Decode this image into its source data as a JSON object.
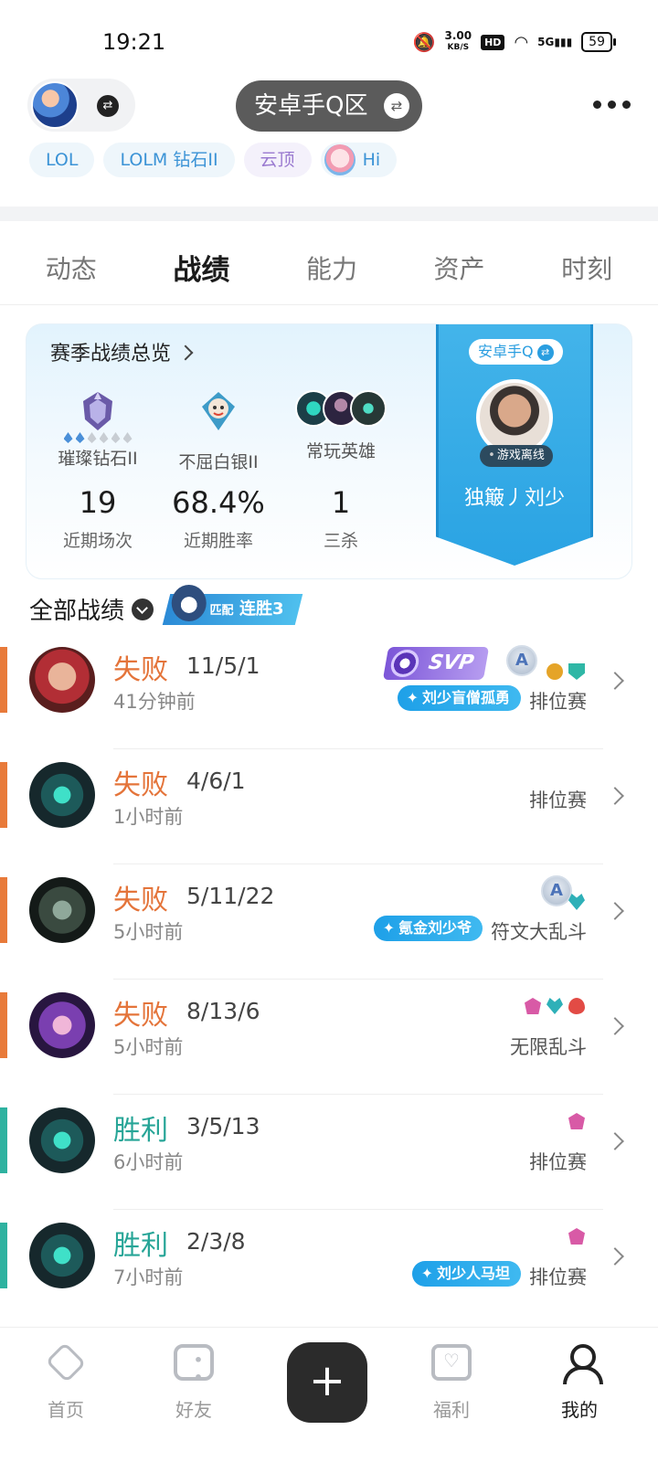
{
  "status_bar": {
    "time": "19:21",
    "speed": "3.00",
    "speed_unit": "KB/S",
    "hd": "HD",
    "network": "5G",
    "battery": "59"
  },
  "header": {
    "region": "安卓手Q区",
    "tags": [
      "LOL",
      "LOLM 钻石II",
      "云顶",
      "Hi"
    ]
  },
  "tabs": [
    {
      "label": "动态",
      "active": false
    },
    {
      "label": "战绩",
      "active": true
    },
    {
      "label": "能力",
      "active": false
    },
    {
      "label": "资产",
      "active": false
    },
    {
      "label": "时刻",
      "active": false
    }
  ],
  "season_summary": {
    "title": "赛季战绩总览",
    "ranks": [
      {
        "label": "璀璨钻石II",
        "pips_total": 6,
        "pips_on": 2
      },
      {
        "label": "不屈白银II"
      },
      {
        "label": "常玩英雄"
      }
    ],
    "stats": [
      {
        "value": "19",
        "caption": "近期场次"
      },
      {
        "value": "68.4%",
        "caption": "近期胜率"
      },
      {
        "value": "1",
        "caption": "三杀"
      }
    ],
    "banner": {
      "platform": "安卓手Q",
      "status": "游戏离线",
      "player_name": "独簸丿刘少"
    }
  },
  "match_list": {
    "title": "全部战绩",
    "streak_mode": "匹配",
    "streak_label": "连胜3",
    "matches": [
      {
        "result": "失败",
        "outcome": "loss",
        "kda": "11/5/1",
        "time_ago": "41分钟前",
        "mode": "排位赛",
        "badge": "刘少盲僧孤勇",
        "svp": "SVP",
        "grade": "A"
      },
      {
        "result": "失败",
        "outcome": "loss",
        "kda": "4/6/1",
        "time_ago": "1小时前",
        "mode": "排位赛"
      },
      {
        "result": "失败",
        "outcome": "loss",
        "kda": "5/11/22",
        "time_ago": "5小时前",
        "mode": "符文大乱斗",
        "badge": "氪金刘少爷",
        "grade": "A"
      },
      {
        "result": "失败",
        "outcome": "loss",
        "kda": "8/13/6",
        "time_ago": "5小时前",
        "mode": "无限乱斗"
      },
      {
        "result": "胜利",
        "outcome": "win",
        "kda": "3/5/13",
        "time_ago": "6小时前",
        "mode": "排位赛"
      },
      {
        "result": "胜利",
        "outcome": "win",
        "kda": "2/3/8",
        "time_ago": "7小时前",
        "mode": "排位赛",
        "badge": "刘少人马坦"
      }
    ]
  },
  "bottom_nav": [
    {
      "label": "首页",
      "icon": "home-icon",
      "active": false
    },
    {
      "label": "好友",
      "icon": "chat-icon",
      "active": false
    },
    {
      "label": "+",
      "icon": "add-icon",
      "active": false
    },
    {
      "label": "福利",
      "icon": "gift-icon",
      "active": false
    },
    {
      "label": "我的",
      "icon": "profile-icon",
      "active": true
    }
  ],
  "colors": {
    "loss": "#e4743a",
    "win": "#27a597",
    "accent_blue": "#2aa3e3"
  }
}
